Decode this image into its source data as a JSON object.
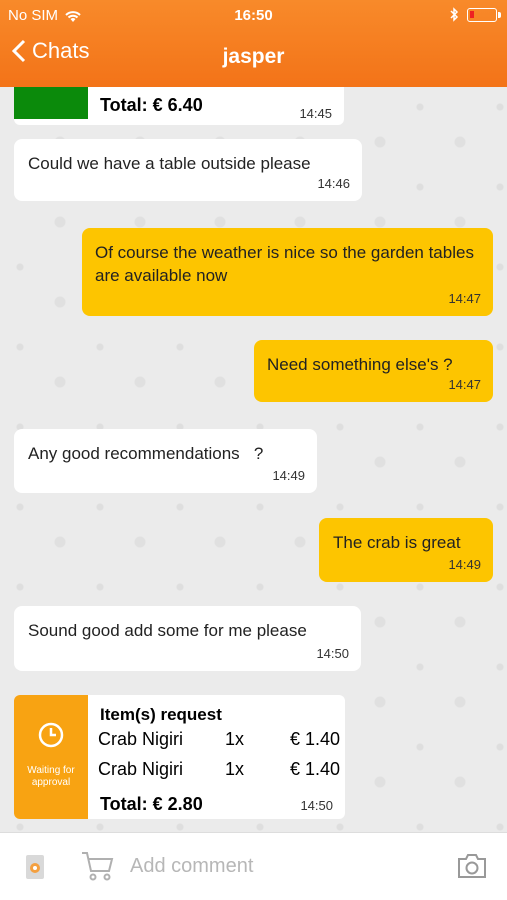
{
  "status_bar": {
    "carrier": "No SIM",
    "time": "16:50"
  },
  "nav": {
    "back_label": "Chats",
    "title": "jasper"
  },
  "top_card": {
    "total": "Total: € 6.40",
    "time": "14:45",
    "swatch_color": "#0b8a0b"
  },
  "messages": [
    {
      "dir": "in",
      "text": "Could we have a table outside please",
      "time": "14:46"
    },
    {
      "dir": "out",
      "text": "Of course the weather is nice so the garden tables are available now",
      "time": "14:47"
    },
    {
      "dir": "out",
      "text": "Need something else's ?",
      "time": "14:47"
    },
    {
      "dir": "in",
      "text": "Any good recommendations   ?",
      "time": "14:49"
    },
    {
      "dir": "out",
      "text": "The crab is great",
      "time": "14:49"
    },
    {
      "dir": "in",
      "text": "Sound good add some for me please",
      "time": "14:50"
    }
  ],
  "request_card": {
    "status": "Waiting for approval",
    "heading": "Item(s) request",
    "items": [
      {
        "name": "Crab Nigiri",
        "qty": "1x",
        "price": "€ 1.40"
      },
      {
        "name": "Crab Nigiri",
        "qty": "1x",
        "price": "€ 1.40"
      }
    ],
    "total": "Total: € 2.80",
    "time": "14:50"
  },
  "composer": {
    "placeholder": "Add comment"
  },
  "colors": {
    "header": "#f37318",
    "outgoing": "#fdc500",
    "incoming": "#ffffff",
    "pending": "#f8a312"
  }
}
